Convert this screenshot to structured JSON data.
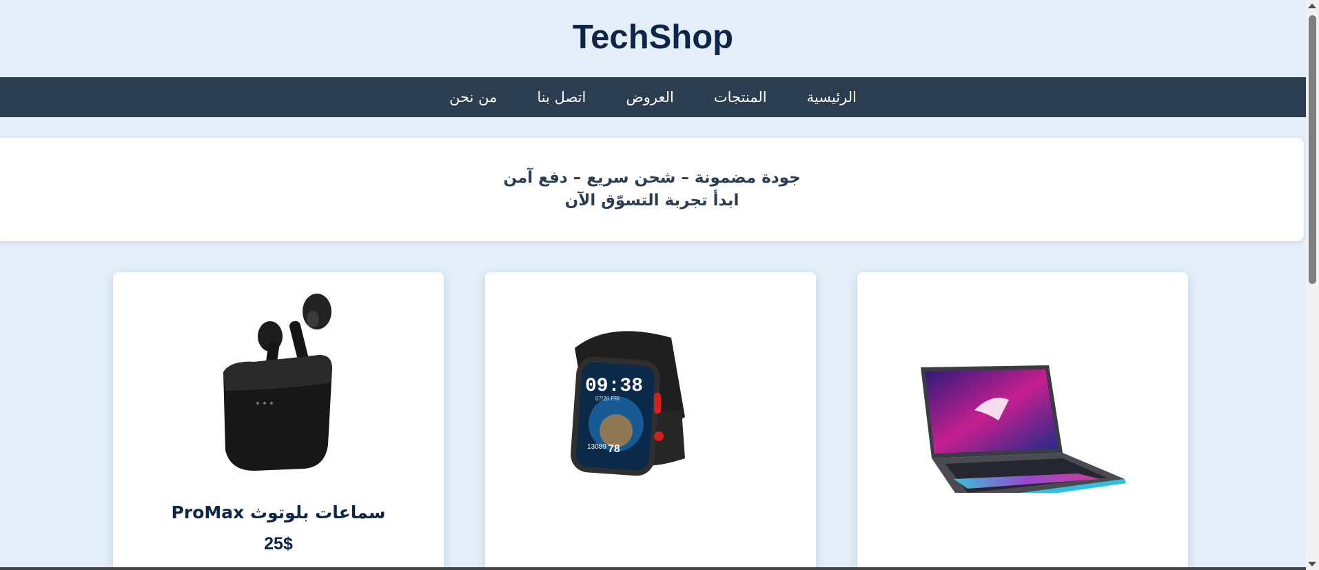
{
  "header": {
    "title": "TechShop"
  },
  "nav": {
    "items": [
      {
        "label": "الرئيسية"
      },
      {
        "label": "المنتجات"
      },
      {
        "label": "العروض"
      },
      {
        "label": "اتصل بنا"
      },
      {
        "label": "من نحن"
      }
    ]
  },
  "hero": {
    "line1": "جودة مضمونة – شحن سريع – دفع آمن",
    "line2": "ابدأ تجربة التسوّق الآن"
  },
  "products": [
    {
      "name": "سماعات بلوتوث ProMax",
      "price": "25$",
      "image_icon": "earbuds-icon"
    },
    {
      "name": "",
      "price": "",
      "image_icon": "smartwatch-icon",
      "watch_time": "09:38",
      "watch_date": "07/26 FRI",
      "watch_steps": "13089",
      "watch_num": "78"
    },
    {
      "name": "",
      "price": "",
      "image_icon": "laptop-icon"
    }
  ],
  "colors": {
    "accent": "#0d2547",
    "nav_bg": "#2b3d50",
    "page_bg": "#e3eef8"
  }
}
